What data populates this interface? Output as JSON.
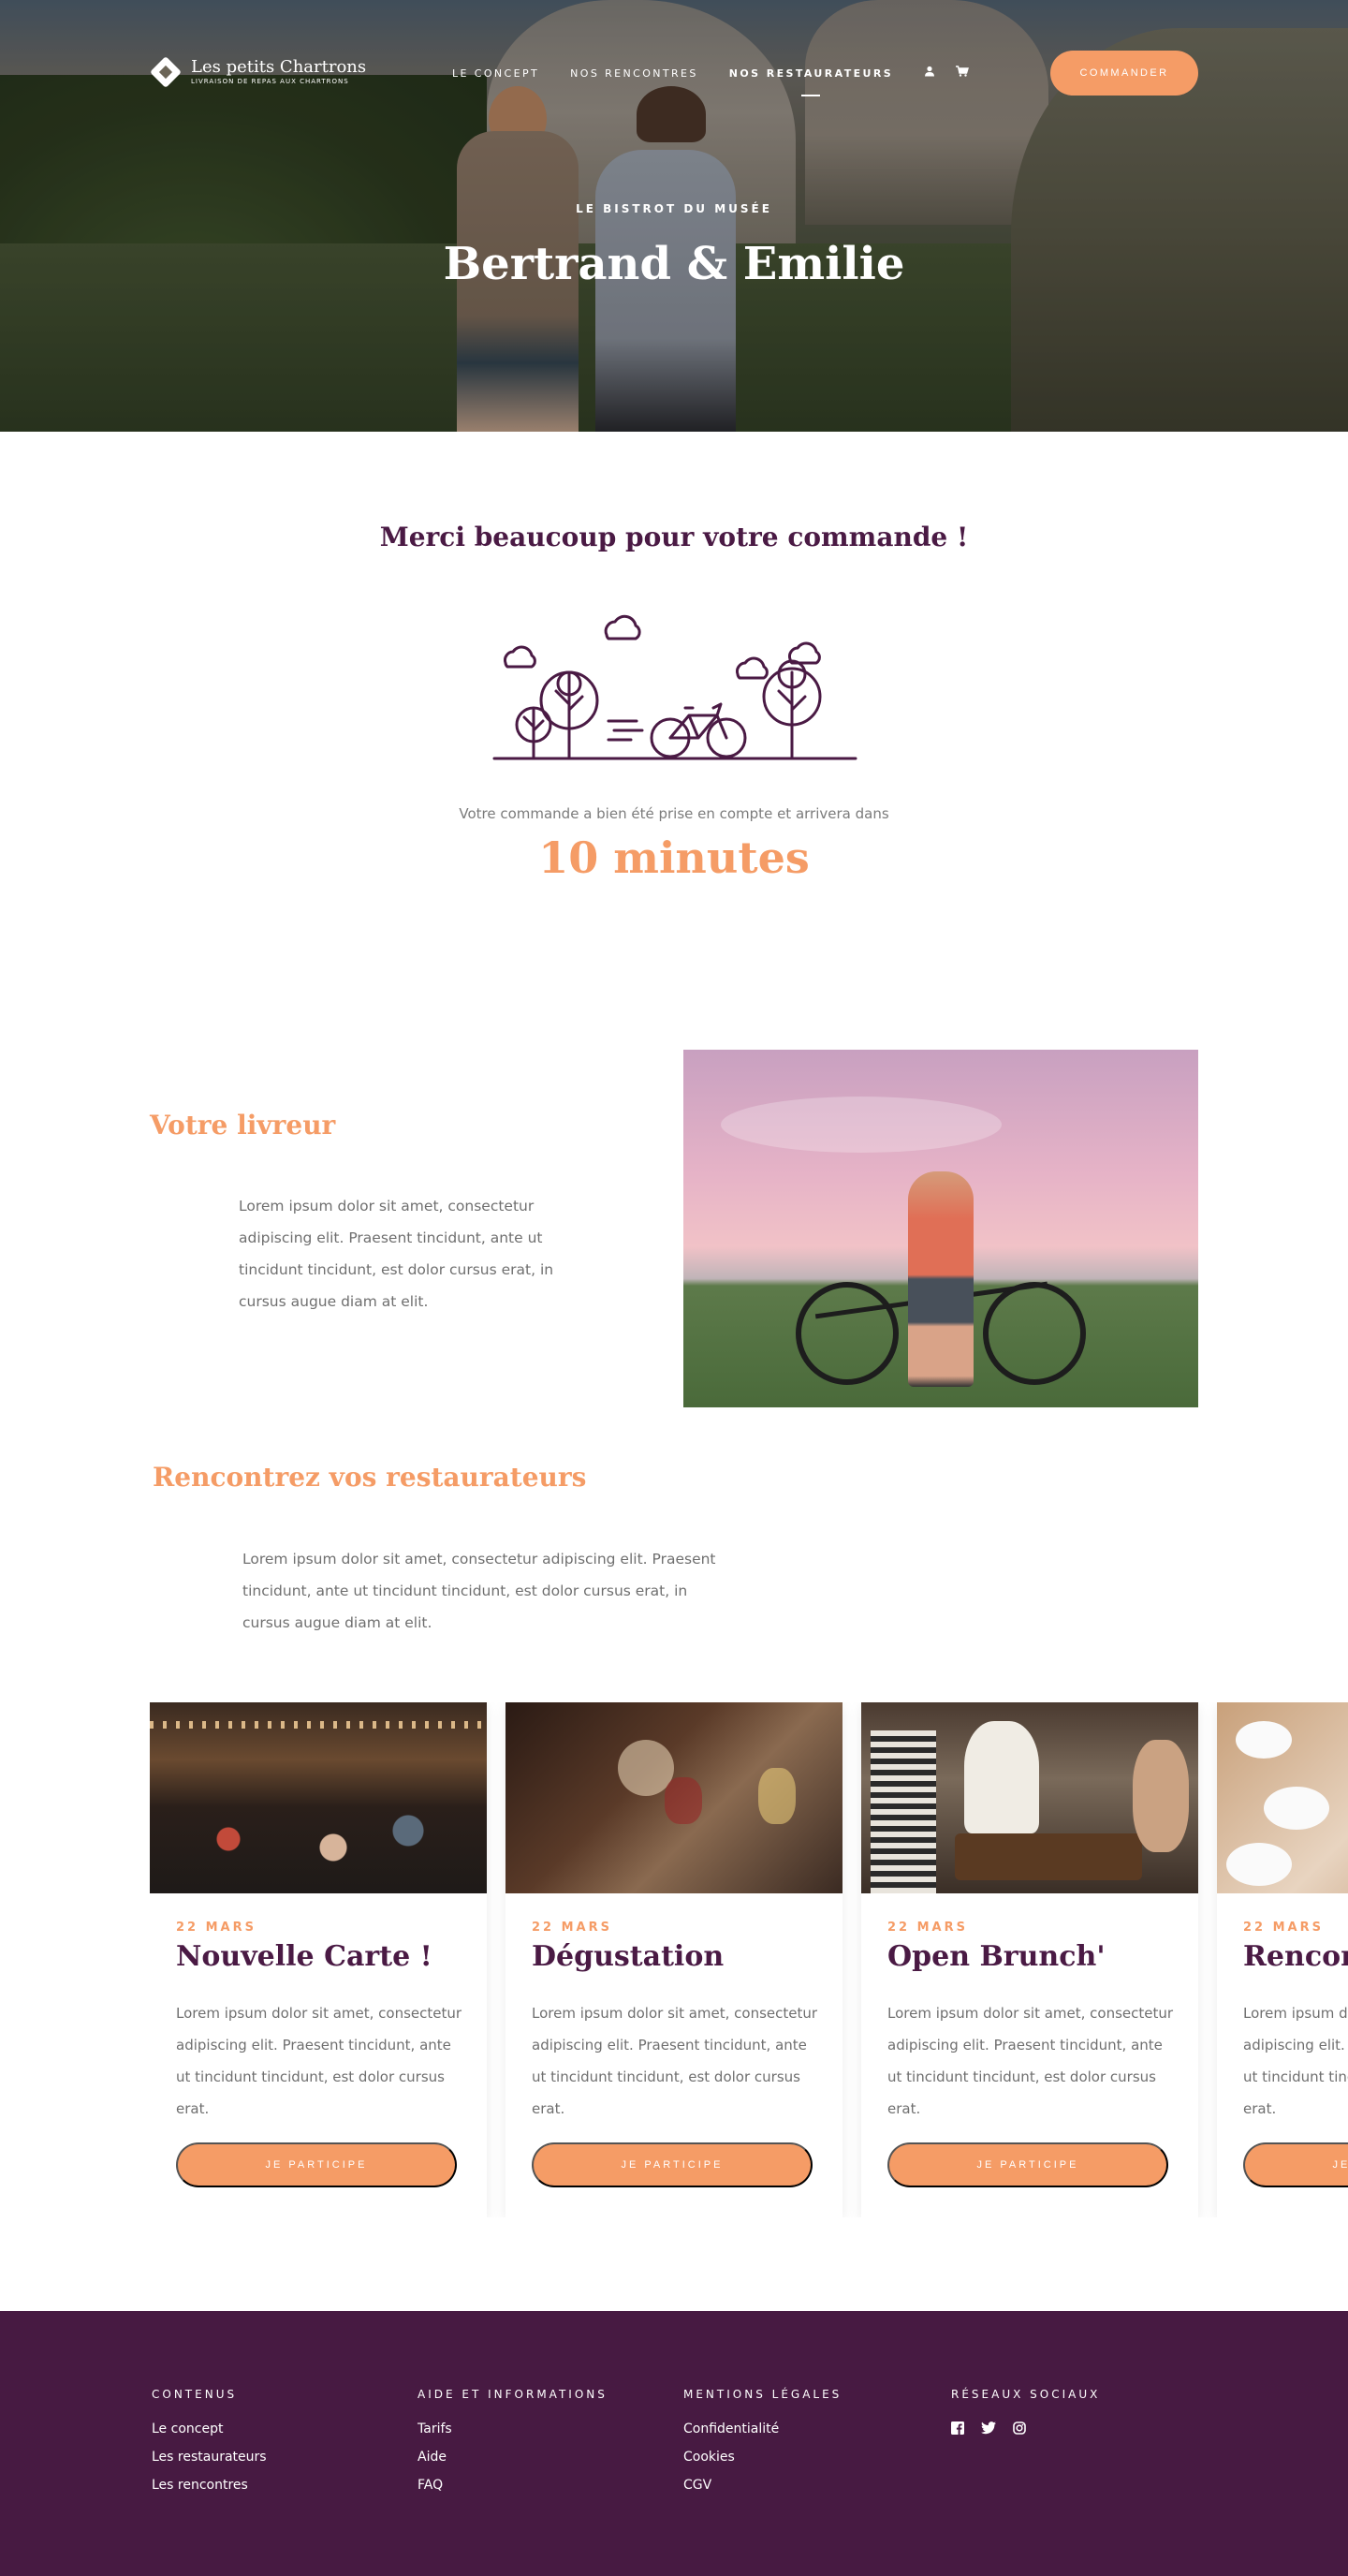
{
  "brand": {
    "name": "Les petits Chartrons",
    "tagline": "LIVRAISON DE REPAS AUX CHARTRONS"
  },
  "nav": {
    "items": [
      {
        "label": "LE CONCEPT",
        "active": false
      },
      {
        "label": "NOS RENCONTRES",
        "active": false
      },
      {
        "label": "NOS RESTAURATEURS",
        "active": true
      }
    ],
    "account_icon": "user-icon",
    "cart_icon": "cart-icon",
    "cta_label": "COMMANDER"
  },
  "hero": {
    "subtitle": "LE BISTROT DU MUSÉE",
    "title": "Bertrand & Emilie"
  },
  "confirmation": {
    "title": "Merci beaucoup pour votre commande !",
    "illustration": "bicycle-trees-illustration",
    "text": "Votre commande a bien été prise en compte et arrivera dans",
    "eta": "10 minutes"
  },
  "livreur": {
    "title": "Votre livreur",
    "text": "Lorem ipsum dolor sit amet, consectetur adipiscing elit. Praesent tincidunt, ante ut tincidunt tincidunt, est dolor cursus erat, in cursus augue diam at elit."
  },
  "restaurateurs": {
    "title": "Rencontrez vos restaurateurs",
    "text": "Lorem ipsum dolor sit amet, consectetur adipiscing elit. Praesent tincidunt, ante ut tincidunt tincidunt, est dolor cursus erat, in cursus augue diam at elit."
  },
  "events": [
    {
      "date": "22 MARS",
      "title": "Nouvelle Carte !",
      "text": "Lorem ipsum dolor sit amet, consectetur adipiscing elit. Praesent tincidunt, ante ut tincidunt tincidunt, est dolor cursus erat.",
      "button": "JE PARTICIPE"
    },
    {
      "date": "22 MARS",
      "title": "Dégustation",
      "text": "Lorem ipsum dolor sit amet, consectetur adipiscing elit. Praesent tincidunt, ante ut tincidunt tincidunt, est dolor cursus erat.",
      "button": "JE PARTICIPE"
    },
    {
      "date": "22 MARS",
      "title": "Open Brunch'",
      "text": "Lorem ipsum dolor sit amet, consectetur adipiscing elit. Praesent tincidunt, ante ut tincidunt tincidunt, est dolor cursus erat.",
      "button": "JE PARTICIPE"
    },
    {
      "date": "22 MARS",
      "title": "Rencontre",
      "text": "Lorem ipsum dolor sit amet, consectetur adipiscing elit. Praesent tincidunt, ante ut tincidunt tincidunt, est dolor cursus erat.",
      "button": "JE PARTICIPE"
    }
  ],
  "footer": {
    "columns": [
      {
        "title": "CONTENUS",
        "links": [
          "Le concept",
          "Les restaurateurs",
          "Les rencontres"
        ]
      },
      {
        "title": "AIDE ET INFORMATIONS",
        "links": [
          "Tarifs",
          "Aide",
          "FAQ"
        ]
      },
      {
        "title": "MENTIONS LÉGALES",
        "links": [
          "Confidentialité",
          "Cookies",
          "CGV"
        ]
      },
      {
        "title": "RÉSEAUX SOCIAUX",
        "icons": [
          "facebook-icon",
          "twitter-icon",
          "instagram-icon"
        ]
      }
    ]
  },
  "colors": {
    "primary": "#4a1a44",
    "accent": "#f59c66",
    "footer_bg": "#471a42",
    "text_muted": "#6f6f6f"
  }
}
